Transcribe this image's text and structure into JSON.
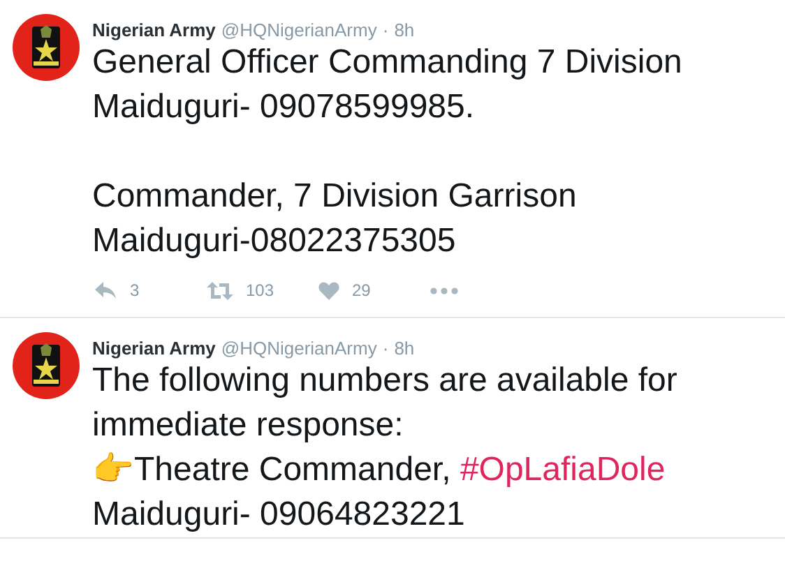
{
  "tweets": [
    {
      "name": "Nigerian Army",
      "handle": "@HQNigerianArmy",
      "separator": "·",
      "time": "8h",
      "parts": [
        {
          "kind": "text",
          "text": "General Officer Commanding 7 Division\nMaiduguri- 09078599985.\n\nCommander, 7 Division Garrison\nMaiduguri-08022375305"
        }
      ],
      "actions": [
        {
          "kind": "reply",
          "count": "3"
        },
        {
          "kind": "retweet",
          "count": "103"
        },
        {
          "kind": "like",
          "count": "29"
        },
        {
          "kind": "more"
        }
      ]
    },
    {
      "name": "Nigerian Army",
      "handle": "@HQNigerianArmy",
      "separator": "·",
      "time": "8h",
      "parts": [
        {
          "kind": "text",
          "text": "The following numbers are available for\nimmediate response:\n👉Theatre Commander, "
        },
        {
          "kind": "hashtag",
          "text": "#OpLafiaDole"
        },
        {
          "kind": "text",
          "text": "\nMaiduguri- 09064823221"
        }
      ]
    }
  ]
}
